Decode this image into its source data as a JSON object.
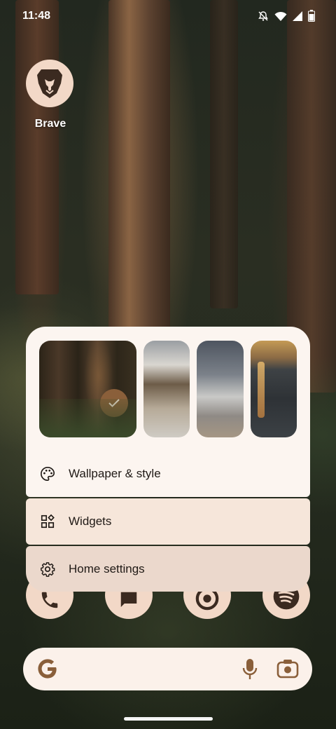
{
  "status_bar": {
    "time": "11:48",
    "icons": [
      "alarm-off-icon",
      "wifi-icon",
      "signal-icon",
      "battery-icon"
    ]
  },
  "home_screen": {
    "apps": [
      {
        "label": "Brave",
        "icon": "brave-lion-icon"
      }
    ],
    "dock": [
      "phone-icon",
      "messages-icon",
      "chrome-icon",
      "spotify-icon"
    ]
  },
  "popup": {
    "wallpapers": [
      {
        "name": "forest",
        "selected": true
      },
      {
        "name": "coast",
        "selected": false
      },
      {
        "name": "mountain",
        "selected": false
      },
      {
        "name": "waterfall",
        "selected": false
      }
    ],
    "items": [
      {
        "label": "Wallpaper & style",
        "icon": "palette-icon"
      },
      {
        "label": "Widgets",
        "icon": "widgets-icon"
      },
      {
        "label": "Home settings",
        "icon": "gear-icon"
      }
    ]
  },
  "search_bar": {
    "icons": [
      "google-g-icon",
      "microphone-icon",
      "lens-camera-icon"
    ]
  },
  "colors": {
    "accent": "#8a5f3a",
    "panel": "#fcf5f0",
    "icon_fg": "#3b2a20"
  }
}
